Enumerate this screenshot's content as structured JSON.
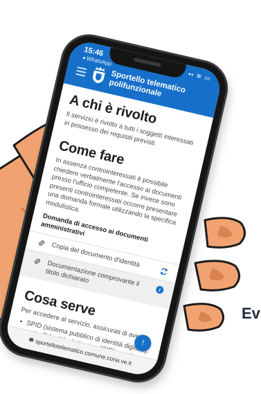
{
  "colors": {
    "accent": "#1670c9",
    "skin": "#f0a371",
    "skin_shadow": "#d9834f",
    "phone_frame": "#151515"
  },
  "status_bar": {
    "time": "15:46",
    "back_app": "◂ WhatsApp",
    "icons": "▪▪ ≋ ▭"
  },
  "app": {
    "title_line1": "Sportello telematico",
    "title_line2": "polifunzionale",
    "menu_icon": "hamburger-menu-icon",
    "logo_icon": "municipal-crest-icon"
  },
  "sections": {
    "audience": {
      "heading": "A chi è rivolto",
      "text": "Il servizio è rivolto a tutti i soggetti interessati in possesso dei requisiti previsti."
    },
    "how_to": {
      "heading": "Come fare",
      "text": "In assenza controinteressati è possibile chiedere verbalmente l'accesso ai documenti presso l'ufficio competente. Se invece sono presenti controinteressati occorre presentare una domanda formale utilizzando la specifica modulistica.",
      "documents_heading": "Domanda di accesso ai documenti amministrativi",
      "documents": [
        {
          "label": "Copia del documento d'identità",
          "icon": "paperclip-icon",
          "action_icon": "refresh-icon"
        },
        {
          "label": "Documentazione comprovante il titolo dichiarato",
          "icon": "paperclip-icon",
          "action_icon": "info-icon"
        }
      ]
    },
    "requirements": {
      "heading": "Cosa serve",
      "intro": "Per accedere al servizio, assicurati di avere:",
      "bullets": [
        "SPID (sistema pubblico di identità digitale), carta d'identità elettronica (CIE) o carta nazionale dei servizi"
      ]
    }
  },
  "browser": {
    "url": "sportellotelematico.comune.cona.ve.it",
    "scroll_top_icon": "arrow-up-icon"
  },
  "overlay_text": "Ev"
}
